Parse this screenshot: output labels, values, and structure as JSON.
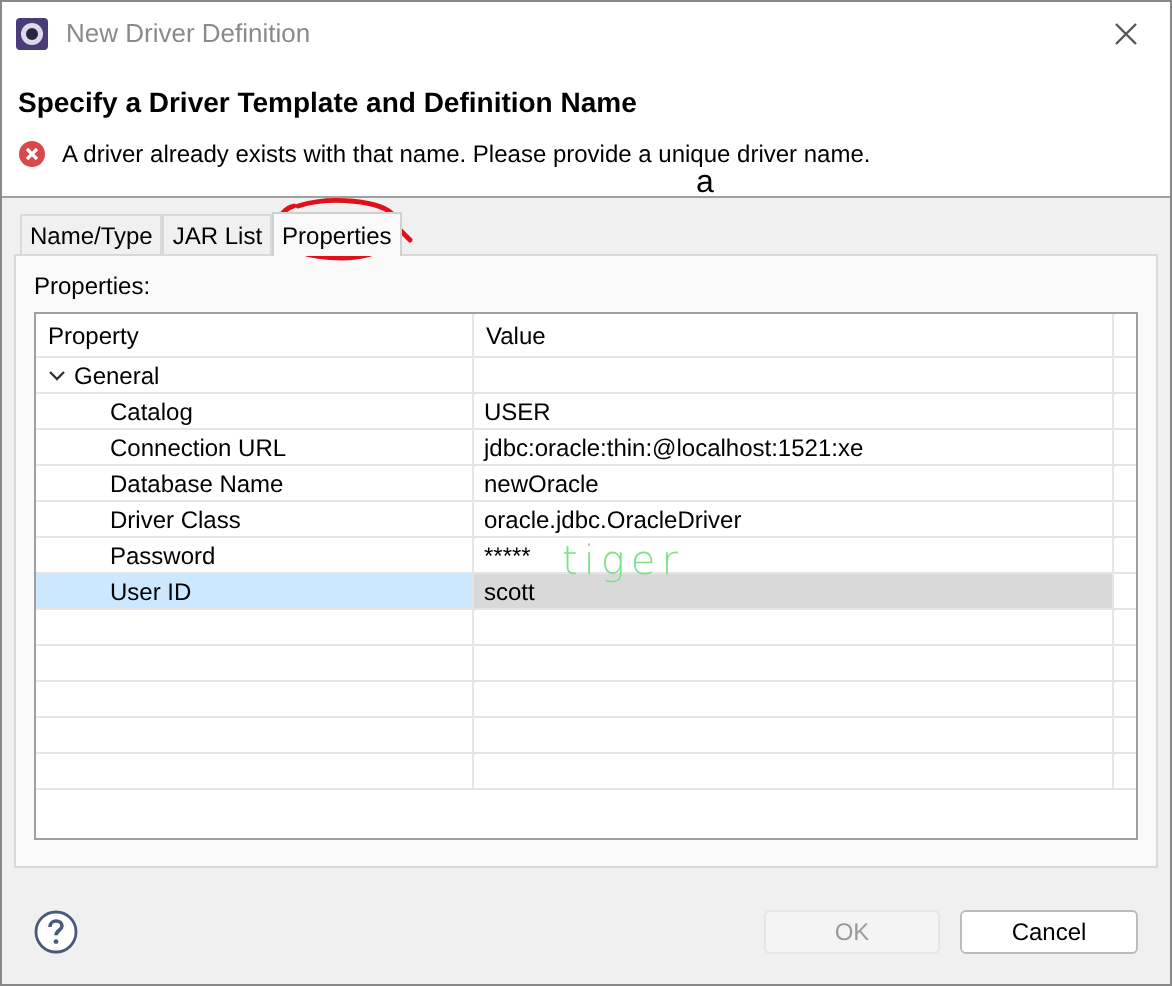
{
  "window": {
    "title": "New Driver Definition"
  },
  "header": {
    "title": "Specify a Driver Template and Definition Name",
    "error": "A driver already exists with that name. Please provide a unique driver name."
  },
  "tabs": [
    {
      "label": "Name/Type",
      "selected": false
    },
    {
      "label": "JAR List",
      "selected": false
    },
    {
      "label": "Properties",
      "selected": true
    }
  ],
  "panel": {
    "label": "Properties:"
  },
  "table": {
    "columns": [
      "Property",
      "Value"
    ],
    "groups": [
      {
        "name": "General",
        "expanded": true,
        "children": [
          {
            "name": "Catalog",
            "value": "USER",
            "selected": false
          },
          {
            "name": "Connection URL",
            "value": "jdbc:oracle:thin:@localhost:1521:xe",
            "selected": false
          },
          {
            "name": "Database Name",
            "value": "newOracle",
            "selected": false
          },
          {
            "name": "Driver Class",
            "value": "oracle.jdbc.OracleDriver",
            "selected": false
          },
          {
            "name": "Password",
            "value": "*****",
            "selected": false
          },
          {
            "name": "User ID",
            "value": "scott",
            "selected": true
          }
        ]
      }
    ]
  },
  "annotations": [
    {
      "kind": "text",
      "text": "a"
    },
    {
      "kind": "handwriting",
      "text": "tiger"
    },
    {
      "kind": "circle"
    }
  ],
  "buttons": [
    {
      "label": "OK",
      "disabled": true
    },
    {
      "label": "Cancel",
      "disabled": false
    }
  ]
}
